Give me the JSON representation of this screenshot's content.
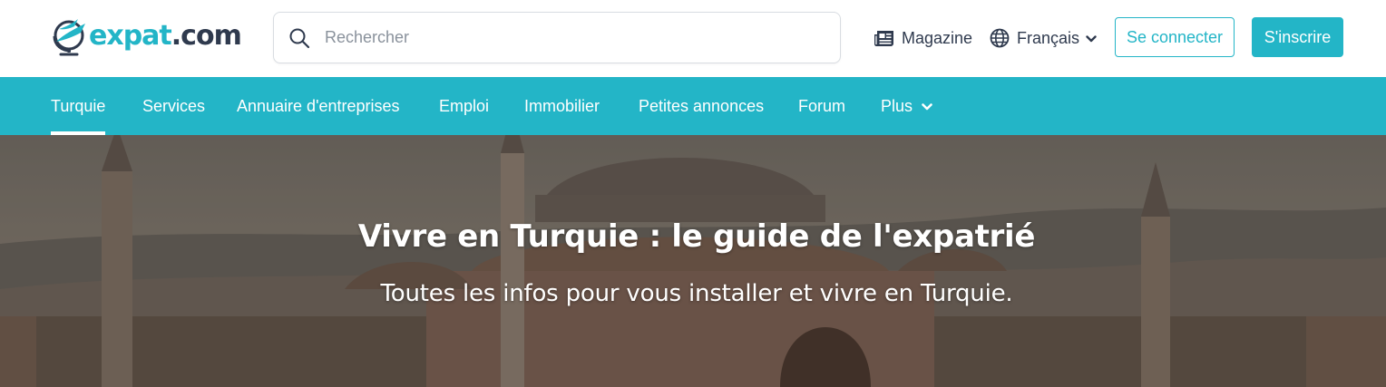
{
  "brand": {
    "logo_part1": "expat",
    "logo_part2": ".",
    "logo_part3": "com",
    "accent_color": "#23b5c7",
    "text_color": "#2f3a4e"
  },
  "search": {
    "placeholder": "Rechercher",
    "value": "",
    "icon": "search-icon"
  },
  "header": {
    "magazine_label": "Magazine",
    "magazine_icon": "newspaper-icon",
    "language_label": "Français",
    "language_icon": "globe-icon",
    "login_label": "Se connecter",
    "signup_label": "S'inscrire"
  },
  "nav": {
    "items": [
      {
        "label": "Turquie",
        "active": true
      },
      {
        "label": "Services"
      },
      {
        "label": "Annuaire d'entreprises"
      },
      {
        "label": "Emploi"
      },
      {
        "label": "Immobilier"
      },
      {
        "label": "Petites annonces"
      },
      {
        "label": "Forum"
      },
      {
        "label": "Plus",
        "icon": "chevron-down-icon"
      }
    ]
  },
  "hero": {
    "title": "Vivre en Turquie : le guide de l'expatrié",
    "subtitle": "Toutes les infos pour vous installer et vivre en Turquie."
  }
}
